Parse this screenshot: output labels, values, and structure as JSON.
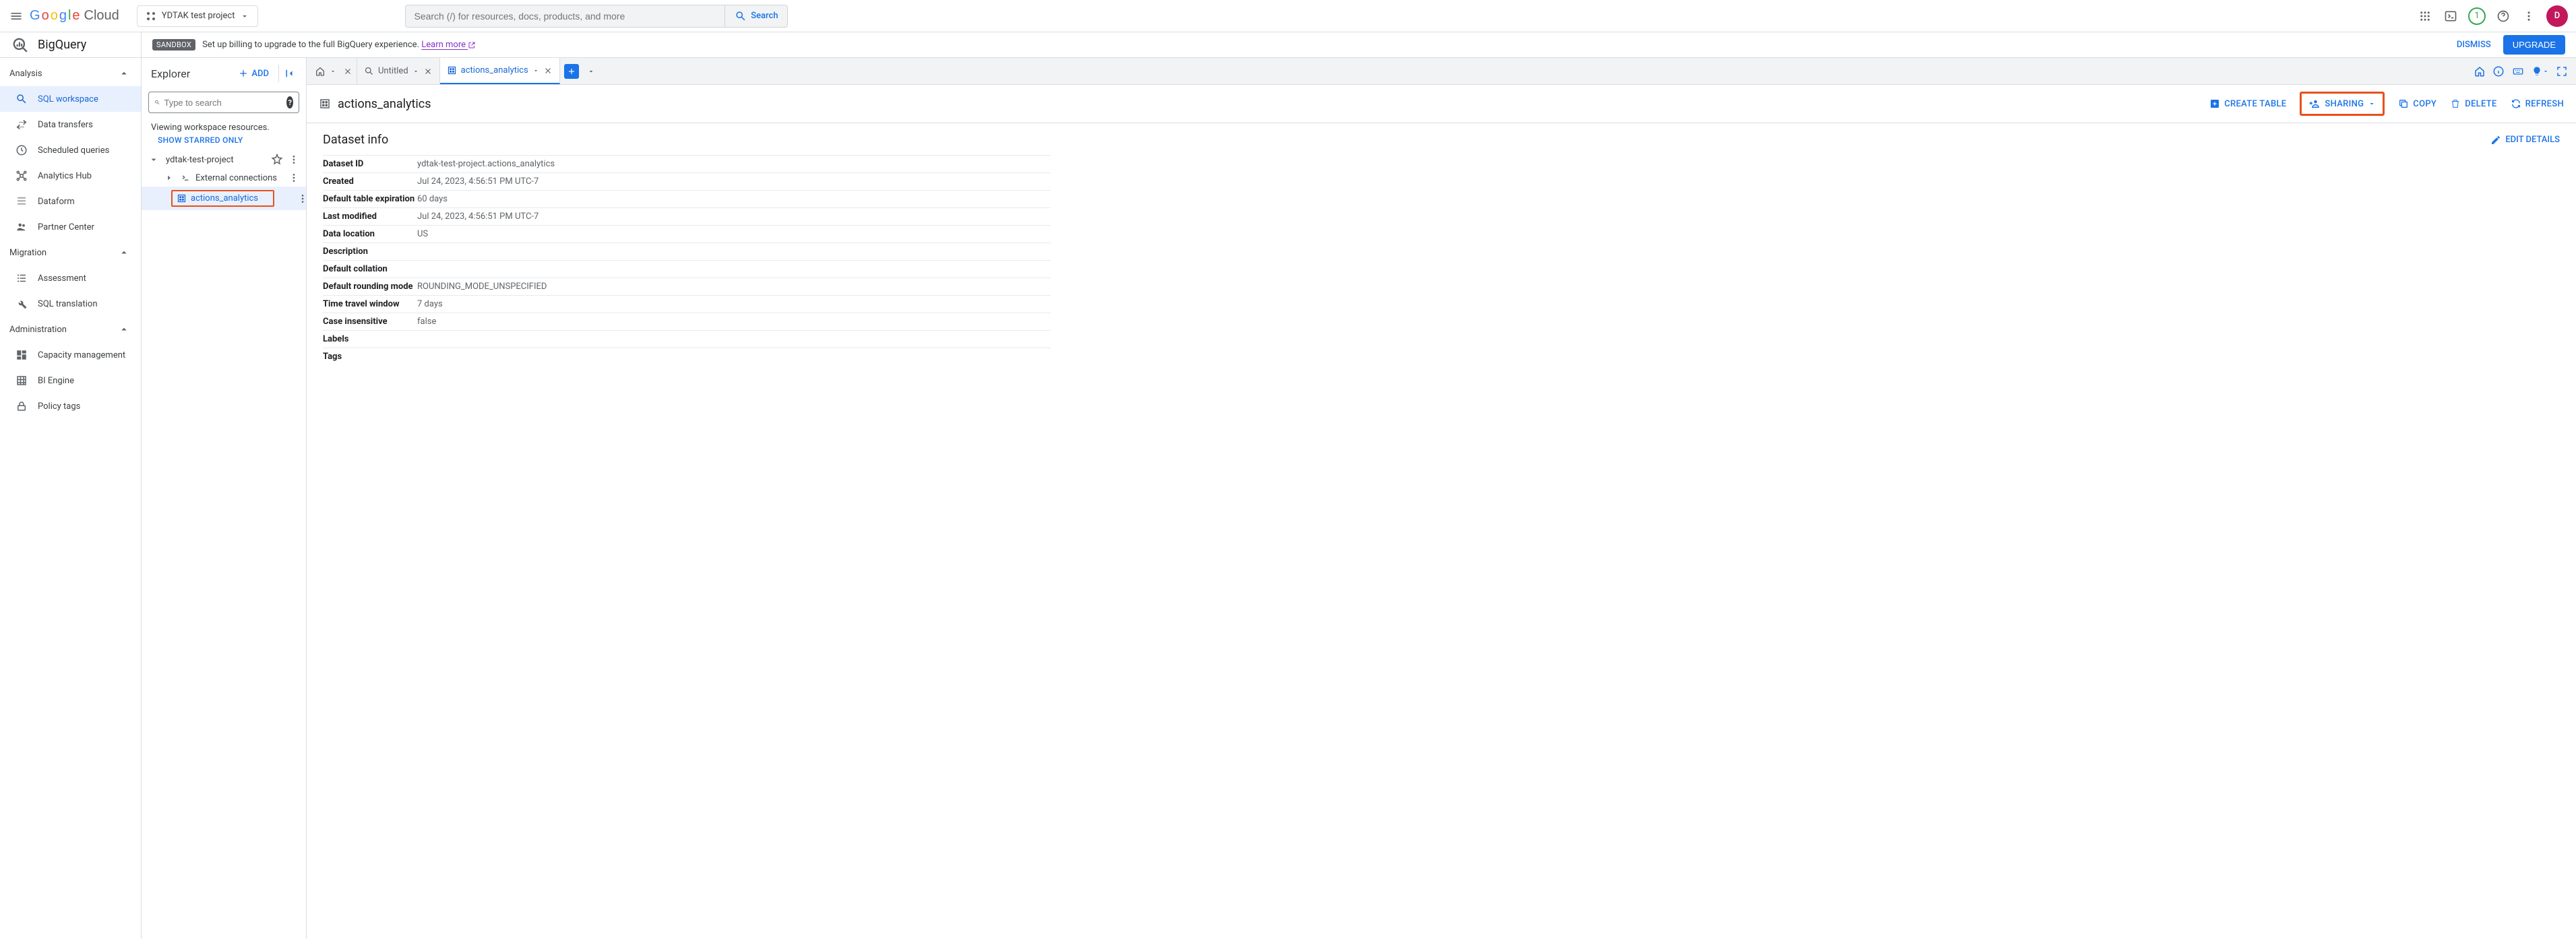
{
  "topbar": {
    "logo_cloud": "Cloud",
    "project_name": "YDTAK test project",
    "search_placeholder": "Search (/) for resources, docs, products, and more",
    "search_button": "Search",
    "notif_count": "1",
    "avatar_initial": "D"
  },
  "banner": {
    "sandbox": "SANDBOX",
    "text": "Set up billing to upgrade to the full BigQuery experience. ",
    "learn_more": "Learn more",
    "dismiss": "DISMISS",
    "upgrade": "UPGRADE"
  },
  "product": {
    "name": "BigQuery"
  },
  "leftnav": {
    "sections": {
      "analysis": "Analysis",
      "migration": "Migration",
      "administration": "Administration"
    },
    "items": {
      "sql_workspace": "SQL workspace",
      "data_transfers": "Data transfers",
      "scheduled_queries": "Scheduled queries",
      "analytics_hub": "Analytics Hub",
      "dataform": "Dataform",
      "partner_center": "Partner Center",
      "assessment": "Assessment",
      "sql_translation": "SQL translation",
      "capacity_management": "Capacity management",
      "bi_engine": "BI Engine",
      "policy_tags": "Policy tags"
    }
  },
  "explorer": {
    "title": "Explorer",
    "add": "ADD",
    "search_placeholder": "Type to search",
    "viewing": "Viewing workspace resources.",
    "show_starred": "SHOW STARRED ONLY",
    "project": "ydtak-test-project",
    "external_conn": "External connections",
    "dataset": "actions_analytics"
  },
  "tabs": {
    "untitled": "Untitled",
    "dataset": "actions_analytics"
  },
  "detail": {
    "title": "actions_analytics",
    "actions": {
      "create_table": "CREATE TABLE",
      "sharing": "SHARING",
      "copy": "COPY",
      "delete": "DELETE",
      "refresh": "REFRESH"
    },
    "section_title": "Dataset info",
    "edit_details": "EDIT DETAILS",
    "rows": [
      {
        "k": "Dataset ID",
        "v": "ydtak-test-project.actions_analytics"
      },
      {
        "k": "Created",
        "v": "Jul 24, 2023, 4:56:51 PM UTC-7"
      },
      {
        "k": "Default table expiration",
        "v": "60 days"
      },
      {
        "k": "Last modified",
        "v": "Jul 24, 2023, 4:56:51 PM UTC-7"
      },
      {
        "k": "Data location",
        "v": "US"
      },
      {
        "k": "Description",
        "v": ""
      },
      {
        "k": "Default collation",
        "v": ""
      },
      {
        "k": "Default rounding mode",
        "v": "ROUNDING_MODE_UNSPECIFIED"
      },
      {
        "k": "Time travel window",
        "v": "7 days"
      },
      {
        "k": "Case insensitive",
        "v": "false"
      },
      {
        "k": "Labels",
        "v": ""
      },
      {
        "k": "Tags",
        "v": ""
      }
    ]
  }
}
